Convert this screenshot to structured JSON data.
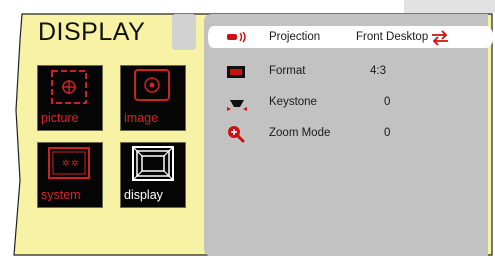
{
  "menu": {
    "title": "DISPLAY"
  },
  "tiles": [
    {
      "label": "picture",
      "label_color": "#dd2222"
    },
    {
      "label": "image",
      "label_color": "#dd2222"
    },
    {
      "label": "system",
      "label_color": "#dd2222"
    },
    {
      "label": "display",
      "label_color": "#ffffff"
    }
  ],
  "settings": [
    {
      "label": "Projection",
      "value": "Front Desktop",
      "icon": "projector-icon"
    },
    {
      "label": "Format",
      "value": "4:3",
      "icon": "aspect-ratio-icon"
    },
    {
      "label": "Keystone",
      "value": "0",
      "icon": "keystone-icon"
    },
    {
      "label": "Zoom Mode",
      "value": "0",
      "icon": "zoom-icon"
    }
  ],
  "colors": {
    "panel_yellow": "#f8f2a4",
    "settings_gray": "#c2c2c2",
    "highlight": "#ffffff",
    "accent_red": "#dd1111"
  }
}
